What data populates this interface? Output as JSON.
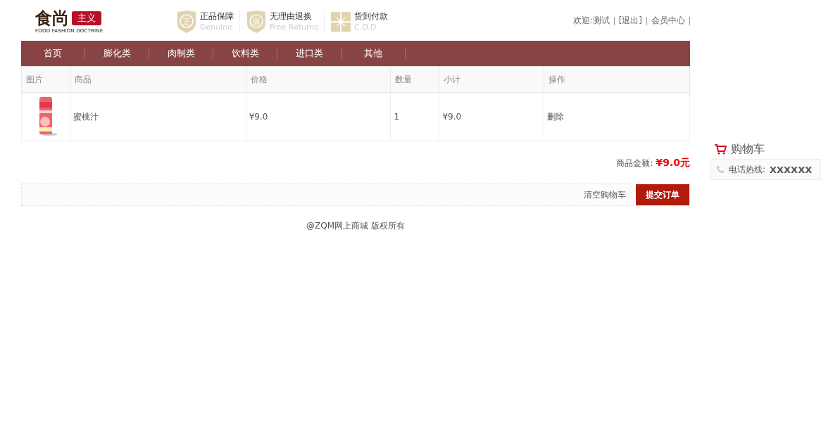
{
  "logo": {
    "main": "食尚",
    "badge": "主义",
    "tagline": "FOOD FASHION DOCTRINE"
  },
  "promises": [
    {
      "kind": "shield",
      "glyph": "正",
      "title": "正品保障",
      "subtitle": "Genuine"
    },
    {
      "kind": "shield",
      "glyph": "退",
      "title": "无理由退换",
      "subtitle": "Free Returns"
    },
    {
      "kind": "gift",
      "title": "货到付款",
      "subtitle": "C.O.D"
    }
  ],
  "user_links": [
    "欢迎:测试",
    "[退出]",
    "会员中心"
  ],
  "nav": [
    "首页",
    "膨化类",
    "肉制类",
    "饮料类",
    "进口类",
    "其他"
  ],
  "table": {
    "columns": [
      "图片",
      "商品",
      "价格",
      "数量",
      "小计",
      "操作"
    ],
    "rows": [
      {
        "name": "蜜桃汁",
        "price": "¥9.0",
        "quantity": "1",
        "subtotal": "¥9.0",
        "action": "删除"
      }
    ]
  },
  "total": {
    "label": "商品金额:",
    "value": "¥9.0元"
  },
  "actions": {
    "clear": "清空购物车",
    "submit": "提交订单"
  },
  "footer": "@ZQM网上商城 版权所有",
  "sidebar": {
    "cart": "购物车",
    "hotline_label": "电话热线:",
    "hotline": "XXXXXX"
  }
}
